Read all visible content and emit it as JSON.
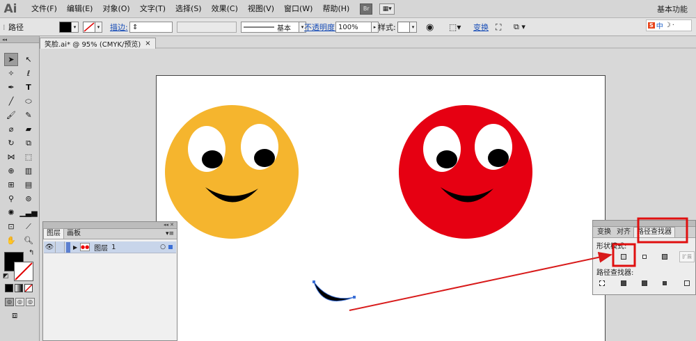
{
  "app": {
    "logo": "Ai",
    "workspace": "基本功能"
  },
  "menu": [
    "文件(F)",
    "编辑(E)",
    "对象(O)",
    "文字(T)",
    "选择(S)",
    "效果(C)",
    "视图(V)",
    "窗口(W)",
    "帮助(H)"
  ],
  "menu_icons": {
    "bridge": "Br",
    "arrange": "arrange-documents-icon"
  },
  "control": {
    "selection_type": "路径",
    "stroke_label": "描边:",
    "stroke_style": "基本",
    "opacity_label": "不透明度:",
    "opacity_value": "100%",
    "style_label": "样式:",
    "transform_label": "变换",
    "ime_label": "中"
  },
  "document": {
    "tab_title": "笑脸.ai* @ 95% (CMYK/预览)",
    "close_glyph": "×"
  },
  "tools": {
    "selected": "selection-tool-icon",
    "icons": [
      "selection-tool-icon",
      "direct-selection-tool-icon",
      "magic-wand-tool-icon",
      "lasso-tool-icon",
      "pen-tool-icon",
      "type-tool-icon",
      "line-tool-icon",
      "ellipse-tool-icon",
      "paintbrush-tool-icon",
      "pencil-tool-icon",
      "blob-brush-tool-icon",
      "eraser-tool-icon",
      "rotate-tool-icon",
      "scale-tool-icon",
      "width-tool-icon",
      "free-transform-tool-icon",
      "shape-builder-tool-icon",
      "perspective-grid-tool-icon",
      "mesh-tool-icon",
      "gradient-tool-icon",
      "eyedropper-tool-icon",
      "blend-tool-icon",
      "symbol-sprayer-tool-icon",
      "column-graph-tool-icon",
      "artboard-tool-icon",
      "slice-tool-icon",
      "hand-tool-icon",
      "zoom-tool-icon"
    ],
    "fill_color": "#000000",
    "stroke_color": "none"
  },
  "artwork": {
    "face_left_color": "#f5b52e",
    "face_right_color": "#e60012",
    "eye_white": "#ffffff",
    "pupil_color": "#000000",
    "mouth_color": "#000000",
    "selection_color": "#3b6fd6"
  },
  "layers": {
    "tabs": [
      "图层",
      "画板"
    ],
    "active_tab": 0,
    "rows": [
      {
        "name": "图层",
        "number": "1"
      }
    ]
  },
  "pathfinder": {
    "tabs": [
      "变换",
      "对齐",
      "路径查找器"
    ],
    "active_tab": 2,
    "shape_modes_label": "形状模式:",
    "pathfinders_label": "路径查找器:",
    "expand_label": "扩展"
  },
  "annotations": {
    "highlight_color": "#e01010",
    "arrow_color": "#d81a1a"
  }
}
